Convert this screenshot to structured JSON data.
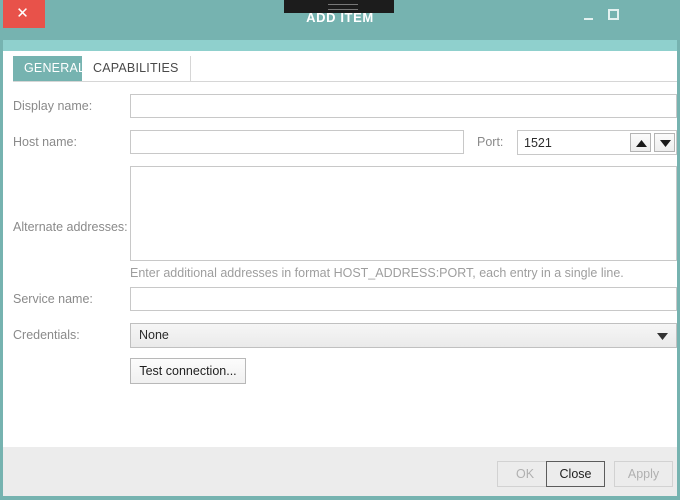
{
  "window": {
    "title": "ADD ITEM",
    "controls": {
      "minimize": "minimize",
      "maximize": "maximize",
      "close": "✕"
    },
    "accent_color": "#76b3b0",
    "accent_light_color": "#8fd0cd",
    "close_button_color": "#e8524a"
  },
  "tabs": [
    {
      "label": "GENERAL",
      "active": true
    },
    {
      "label": "CAPABILITIES",
      "active": false
    }
  ],
  "form": {
    "display_name": {
      "label": "Display name:",
      "value": "",
      "placeholder": ""
    },
    "host_name": {
      "label": "Host name:",
      "value": "",
      "placeholder": ""
    },
    "port": {
      "label": "Port:",
      "value": "1521"
    },
    "alternate_addresses": {
      "label": "Alternate addresses:",
      "value": "",
      "hint": "Enter additional addresses in format HOST_ADDRESS:PORT, each entry in a single line."
    },
    "service_name": {
      "label": "Service name:",
      "value": "",
      "placeholder": ""
    },
    "credentials": {
      "label": "Credentials:",
      "selected": "None",
      "options": [
        "None"
      ]
    },
    "test_connection_label": "Test connection..."
  },
  "footer": {
    "ok_label": "OK",
    "close_label": "Close",
    "apply_label": "Apply"
  }
}
